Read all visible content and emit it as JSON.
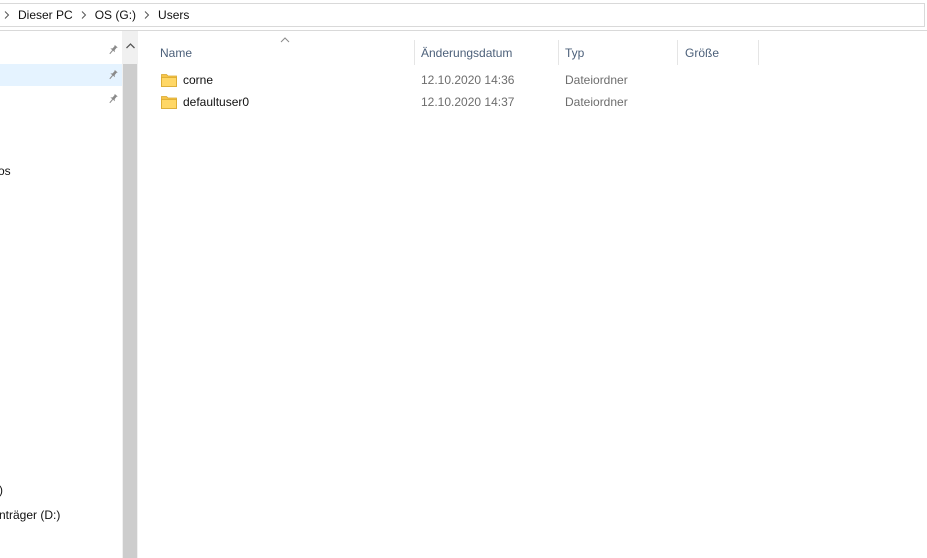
{
  "breadcrumb": {
    "items": [
      "Dieser PC",
      "OS (G:)",
      "Users"
    ]
  },
  "nav": {
    "items": [
      {
        "label": "",
        "pinned": true,
        "selected": false
      },
      {
        "label": "",
        "pinned": true,
        "selected": true
      },
      {
        "label": "",
        "pinned": true,
        "selected": false
      },
      {
        "label": "os",
        "pinned": false,
        "selected": false
      },
      {
        "label": ")",
        "pinned": false,
        "selected": false
      },
      {
        "label": "nträger (D:)",
        "pinned": false,
        "selected": false
      }
    ]
  },
  "columns": {
    "name": "Name",
    "date": "Änderungsdatum",
    "type": "Typ",
    "size": "Größe"
  },
  "files": [
    {
      "name": "corne",
      "date": "12.10.2020 14:36",
      "type": "Dateiordner"
    },
    {
      "name": "defaultuser0",
      "date": "12.10.2020 14:37",
      "type": "Dateiordner"
    }
  ],
  "colors": {
    "selected_bg": "#e5f3ff",
    "header_text": "#4c607a",
    "folder": "#ffd766"
  },
  "icons": {
    "pin": "pin-icon",
    "folder": "folder-icon",
    "chevron": "chevron-right-icon",
    "scroll_up": "scroll-up-arrow-icon",
    "sort": "sort-ascending-icon"
  }
}
